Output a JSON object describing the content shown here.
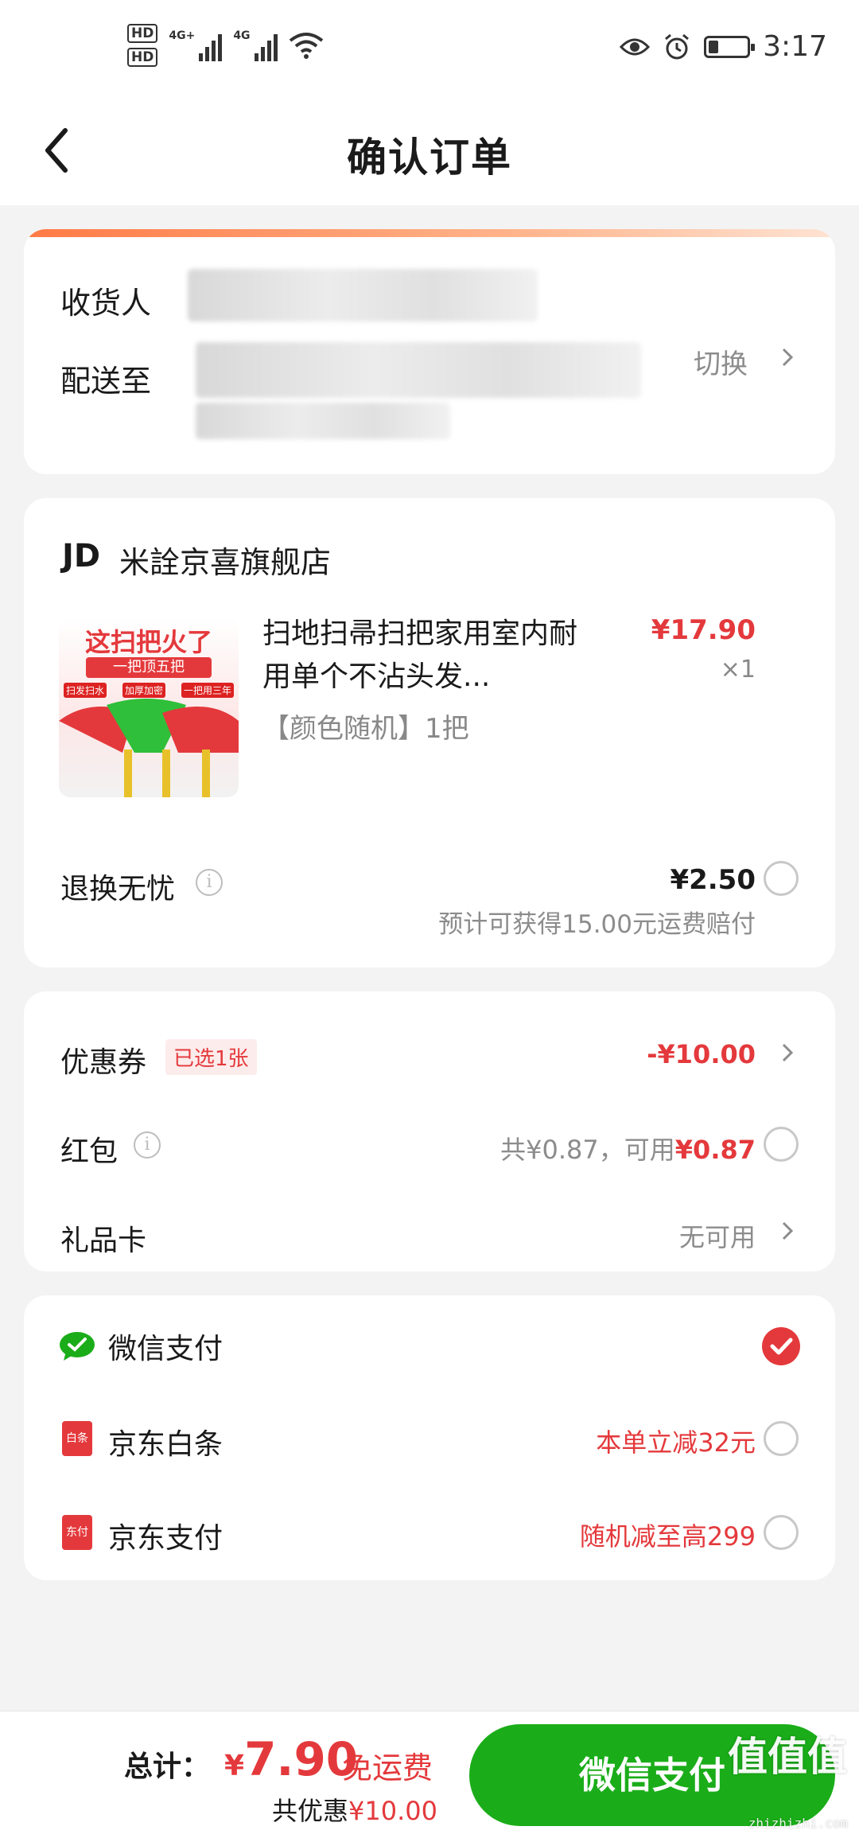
{
  "status_bar": {
    "hd1": "HD",
    "hd2": "HD",
    "net1": "4G+",
    "net2": "4G",
    "time": "3:17",
    "battery_level": 0.25
  },
  "header": {
    "title": "确认订单"
  },
  "address": {
    "recipient_label": "收货人",
    "deliver_to_label": "配送至",
    "switch_label": "切换"
  },
  "store": {
    "logo": "JD",
    "name": "米詮京喜旗舰店",
    "product": {
      "image_headline": "这扫把火了",
      "image_sub": "一把顶五把",
      "image_tags": [
        "扫发扫水",
        "加厚加密",
        "一把用三年"
      ],
      "title": "扫地扫帚扫把家用室内耐用单个不沾头发...",
      "spec": "【颜色随机】1把",
      "price": "¥17.90",
      "qty": "×1"
    },
    "return_worry": {
      "label": "退换无忧",
      "price": "¥2.50",
      "note": "预计可获得15.00元运费赔付"
    }
  },
  "discounts": {
    "coupon_label": "优惠券",
    "coupon_badge": "已选1张",
    "coupon_value": "-¥10.00",
    "redpacket_label": "红包",
    "redpacket_total": "共¥0.87，可用",
    "redpacket_avail": "¥0.87",
    "giftcard_label": "礼品卡",
    "giftcard_value": "无可用"
  },
  "payment": {
    "wechat_label": "微信支付",
    "baitiao_label": "京东白条",
    "baitiao_promo": "本单立减32元",
    "baitiao_icon_text": "白条",
    "jdpay_label": "京东支付",
    "jdpay_promo": "随机减至高299",
    "jdpay_icon_text": "东付",
    "selected": "wechat"
  },
  "bottom": {
    "total_label": "总计：",
    "currency": "¥",
    "total": "7.90",
    "free_shipping": "免运费",
    "saving_label": "共优惠",
    "saving_value": "¥10.00",
    "pay_button": "微信支付"
  },
  "watermark": {
    "text": "值值值",
    "sub": "zhizhizhi.com"
  },
  "colors": {
    "accent_red": "#e4393c",
    "wechat_green": "#1aad19"
  }
}
